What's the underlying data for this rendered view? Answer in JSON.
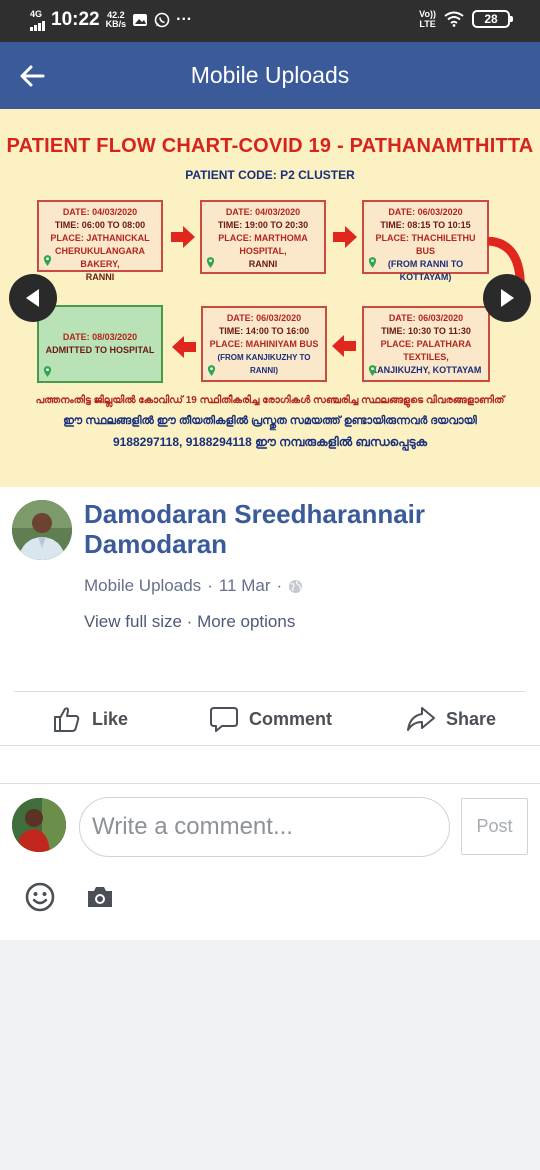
{
  "status_bar": {
    "network": "4G",
    "time": "10:22",
    "speed_value": "42.2",
    "speed_unit": "KB/s",
    "more": "···",
    "volte_top": "Vo))",
    "volte_bottom": "LTE",
    "battery": "28"
  },
  "app_bar": {
    "title": "Mobile Uploads",
    "back_icon": "back-arrow-icon"
  },
  "photo": {
    "title": "PATIENT FLOW CHART-COVID 19 - PATHANAMTHITTA",
    "code": "PATIENT CODE: P2 CLUSTER",
    "boxes": [
      {
        "date": "DATE: 04/03/2020",
        "time": "TIME:  06:00 TO 08:00",
        "place": "PLACE: JATHANICKAL",
        "detail": "CHERUKULANGARA BAKERY,",
        "extra": "RANNI"
      },
      {
        "date": "DATE: 04/03/2020",
        "time": "TIME: 19:00 TO 20:30",
        "place": "PLACE: MARTHOMA",
        "detail": "HOSPITAL,",
        "extra": "RANNI"
      },
      {
        "date": "DATE: 06/03/2020",
        "time": "TIME:  08:15 TO 10:15",
        "place": "PLACE: THACHILETHU BUS",
        "detail": "(FROM RANNI TO KOTTAYAM)",
        "extra": ""
      },
      {
        "date": "DATE: 08/03/2020",
        "time": "ADMITTED TO HOSPITAL",
        "place": "",
        "detail": "",
        "extra": ""
      },
      {
        "date": "DATE: 06/03/2020",
        "time": "TIME: 14:00 TO 16:00",
        "place": "PLACE: MAHINIYAM BUS",
        "detail": "(FROM KANJIKUZHY TO RANNI)",
        "extra": ""
      },
      {
        "date": "DATE: 06/03/2020",
        "time": "TIME: 10:30 TO 11:30",
        "place": "PLACE: PALATHARA TEXTILES,",
        "detail": "KANJIKUZHY, KOTTAYAM",
        "extra": ""
      }
    ],
    "malayalam_line1": "പത്തനംതിട്ട ജില്ലയിൽ കോവിഡ് 19 സ്ഥിതീകരിച്ച രോഗികൾ സഞ്ചരിച്ച സ്ഥലങ്ങളുടെ വിവരങ്ങളാണിത്",
    "malayalam_line2": "ഈ സ്ഥലങ്ങളിൽ ഈ തീയതികളിൽ പ്രസ്തുത സമയത്ത് ഉണ്ടായിരുന്നവർ ദയവായി",
    "malayalam_line3": "9188297118, 9188294118 ഈ നമ്പരുകളിൽ ബന്ധപ്പെടുക"
  },
  "post": {
    "author": "Damodaran Sreedharannair Damodaran",
    "album": "Mobile Uploads",
    "date": "11 Mar",
    "privacy_icon": "globe-icon",
    "view_full_size": "View full size",
    "more_options": "More options",
    "separator": " · "
  },
  "actions": {
    "like": "Like",
    "comment": "Comment",
    "share": "Share"
  },
  "comment_box": {
    "placeholder": "Write a comment...",
    "post_label": "Post"
  },
  "colors": {
    "brand": "#3b5a9a",
    "status_bar": "#2f2f2f",
    "photo_bg": "#fbf1c2",
    "flow_red": "#d8231c"
  }
}
